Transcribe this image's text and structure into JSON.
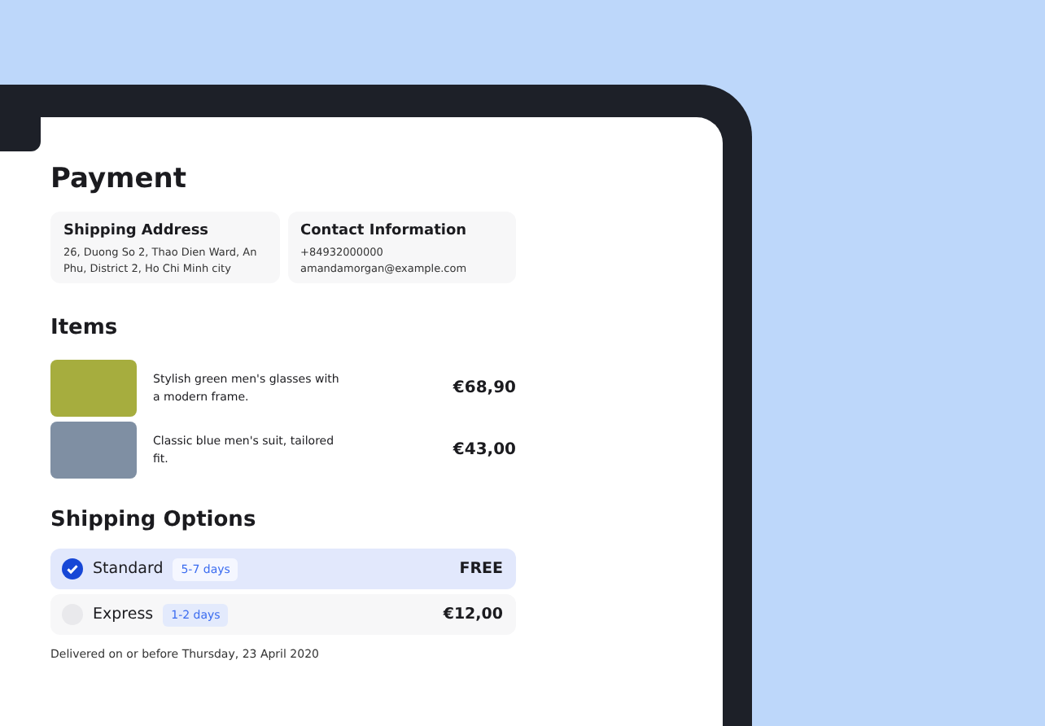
{
  "title": "Payment",
  "info_cards": [
    {
      "heading": "Shipping Address",
      "lines": [
        "26, Duong So 2, Thao Dien Ward, An Phu, District 2, Ho Chi Minh city"
      ]
    },
    {
      "heading": "Contact Information",
      "lines": [
        "+84932000000",
        "amandamorgan@example.com"
      ]
    }
  ],
  "items_heading": "Items",
  "items": [
    {
      "description": "Stylish green men's glasses with a modern frame.",
      "price": "€68,90"
    },
    {
      "description": "Classic blue men's suit, tailored fit.",
      "price": "€43,00"
    }
  ],
  "shipping_heading": "Shipping Options",
  "shipping_options": [
    {
      "name": "Standard",
      "duration": "5-7 days",
      "price": "FREE",
      "selected": true
    },
    {
      "name": "Express",
      "duration": "1-2 days",
      "price": "€12,00",
      "selected": false
    }
  ],
  "delivery_note": "Delivered on or before Thursday, 23 April 2020"
}
